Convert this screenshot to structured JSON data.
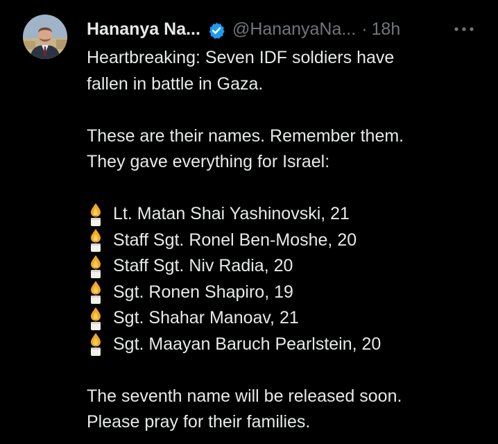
{
  "tweet": {
    "author": {
      "display_name": "Hananya Na...",
      "handle": "@HananyaNa...",
      "verified": true
    },
    "separator": "·",
    "timestamp": "18h",
    "more_icon": "more-horizontal-icon",
    "text": {
      "intro_line1": "Heartbreaking: Seven IDF soldiers have",
      "intro_line2": "fallen in battle in Gaza.",
      "names_intro_line1": "These are their names. Remember them.",
      "names_intro_line2": "They gave everything for Israel:",
      "list_icon": "candle-icon",
      "soldiers": [
        "Lt. Matan Shai Yashinovski, 21",
        "Staff Sgt. Ronel Ben-Moshe, 20",
        "Staff Sgt. Niv Radia, 20",
        "Sgt. Ronen Shapiro, 19",
        "Sgt. Shahar Manoav, 21",
        "Sgt. Maayan Baruch Pearlstein, 20"
      ],
      "closing_line1": "The seventh name will be released soon.",
      "closing_line2": "Please pray for their families."
    }
  },
  "colors": {
    "background": "#000000",
    "primary_text": "#e7e9ea",
    "secondary_text": "#71767b",
    "verified_badge": "#1d9bf0"
  }
}
